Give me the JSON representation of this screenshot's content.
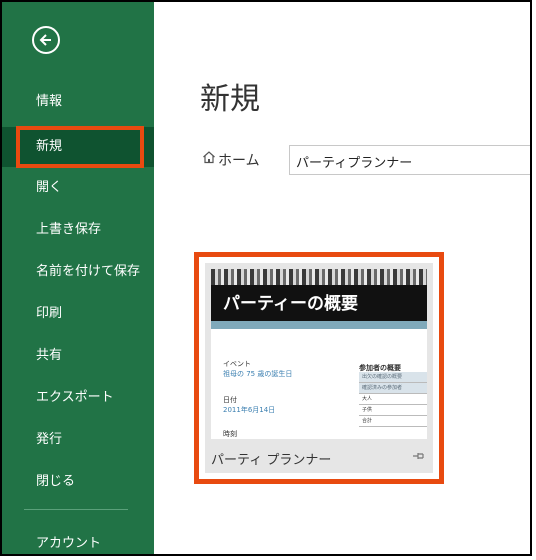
{
  "sidebar": {
    "items": [
      {
        "label": "情報"
      },
      {
        "label": "新規"
      },
      {
        "label": "開く"
      },
      {
        "label": "上書き保存"
      },
      {
        "label": "名前を付けて保存"
      },
      {
        "label": "印刷"
      },
      {
        "label": "共有"
      },
      {
        "label": "エクスポート"
      },
      {
        "label": "発行"
      },
      {
        "label": "閉じる"
      },
      {
        "label": "アカウント"
      }
    ],
    "selected": "新規",
    "back_icon": "arrow-left-circle-icon",
    "color": "#217346",
    "selected_color": "#0f5330",
    "highlight_color": "#e84a10"
  },
  "main": {
    "title": "新規",
    "breadcrumb": {
      "home_label": "ホーム",
      "home_icon": "home-icon"
    },
    "search": {
      "value": "パーティプランナー"
    },
    "templates": [
      {
        "name": "パーティ プランナー",
        "pin_icon": "pin-icon",
        "thumbnail": {
          "heading": "パーティーの概要",
          "event_label": "イベント",
          "event_value": "祖母の 75 歳の誕生日",
          "date_label": "日付",
          "date_value": "2011年6月14日",
          "time_label": "時刻",
          "attendance_heading": "参加者の概要",
          "attendance_rows": [
            "出欠の確認の概要",
            "確認済みの参加者",
            "大人",
            "子供",
            "合計"
          ]
        }
      }
    ]
  }
}
